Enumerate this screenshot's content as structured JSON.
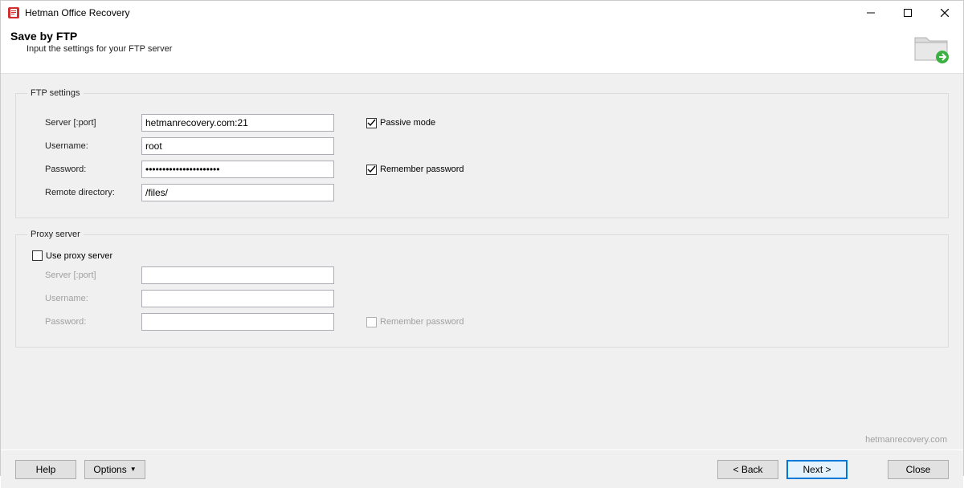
{
  "window": {
    "title": "Hetman Office Recovery"
  },
  "header": {
    "title": "Save by FTP",
    "subtitle": "Input the settings for your FTP server"
  },
  "ftp": {
    "legend": "FTP settings",
    "server_label": "Server [:port]",
    "server_value": "hetmanrecovery.com:21",
    "passive_label": "Passive mode",
    "passive_checked": true,
    "username_label": "Username:",
    "username_value": "root",
    "password_label": "Password:",
    "password_value": "••••••••••••••••••••••",
    "remember_label": "Remember password",
    "remember_checked": true,
    "remote_dir_label": "Remote directory:",
    "remote_dir_value": "/files/"
  },
  "proxy": {
    "legend": "Proxy server",
    "use_proxy_label": "Use proxy server",
    "use_proxy_checked": false,
    "server_label": "Server [:port]",
    "server_value": "",
    "username_label": "Username:",
    "username_value": "",
    "password_label": "Password:",
    "password_value": "",
    "remember_label": "Remember password",
    "remember_checked": false
  },
  "footer": {
    "brand": "hetmanrecovery.com",
    "help": "Help",
    "options": "Options",
    "back": "< Back",
    "next": "Next >",
    "close": "Close"
  }
}
